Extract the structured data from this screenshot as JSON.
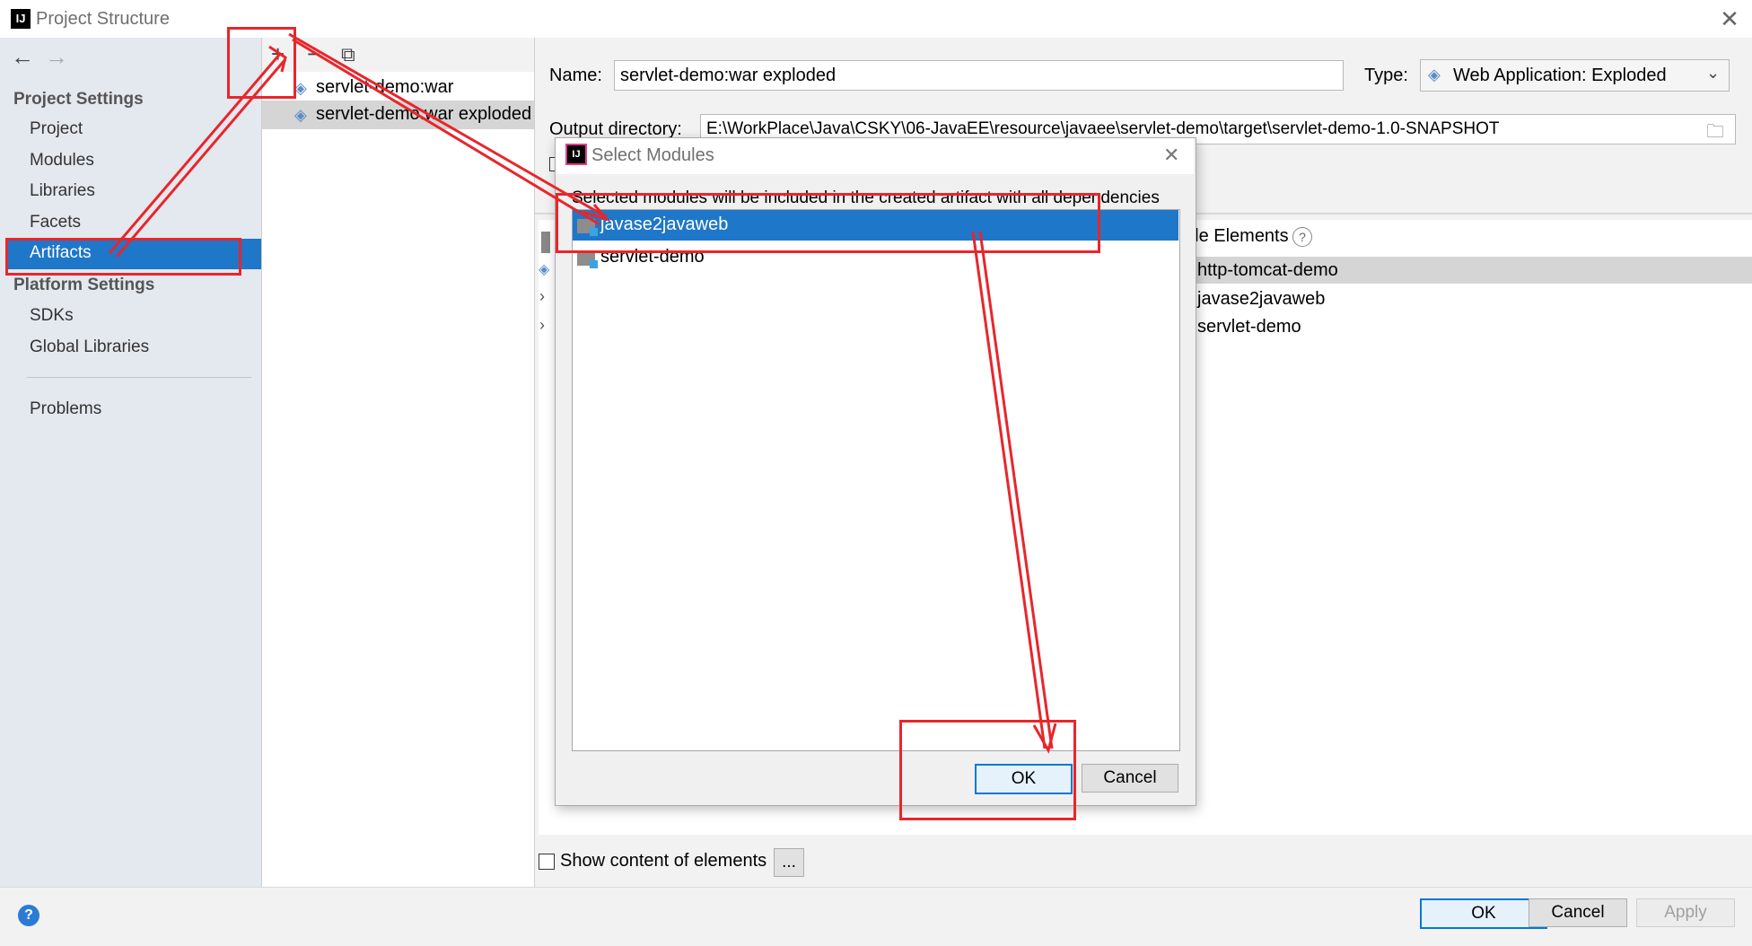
{
  "window": {
    "title": "Project Structure",
    "logo_text": "IJ",
    "close_glyph": "✕"
  },
  "nav": {
    "back_glyph": "←",
    "forward_glyph": "→",
    "project_settings_header": "Project Settings",
    "project_items": [
      "Project",
      "Modules",
      "Libraries",
      "Facets",
      "Artifacts"
    ],
    "platform_settings_header": "Platform Settings",
    "platform_items": [
      "SDKs",
      "Global Libraries"
    ],
    "problems": "Problems"
  },
  "artifacts_toolbar": {
    "add": "+",
    "remove": "−",
    "copy": "⧉"
  },
  "artifacts": [
    "servlet-demo:war",
    "servlet-demo:war exploded"
  ],
  "editor": {
    "name_label": "Name:",
    "name_value": "servlet-demo:war exploded",
    "type_label": "Type:",
    "type_value": "Web Application: Exploded",
    "output_label": "Output directory:",
    "output_value": "E:\\WorkPlace\\Java\\CSKY\\06-JavaEE\\resource\\javaee\\servlet-demo\\target\\servlet-demo-1.0-SNAPSHOT",
    "available_elements_partial": "ble Elements",
    "help_glyph": "?",
    "available_items": [
      "http-tomcat-demo",
      "javase2javaweb",
      "servlet-demo"
    ],
    "show_content_label": "Show content of elements",
    "ellipsis_button": "..."
  },
  "dialog": {
    "title": "Select Modules",
    "close_glyph": "✕",
    "description": "Selected modules will be included in the created artifact with all dependencies",
    "modules": [
      "javase2javaweb",
      "servlet-demo"
    ],
    "ok": "OK",
    "cancel": "Cancel"
  },
  "footer": {
    "help": "?",
    "ok": "OK",
    "cancel": "Cancel",
    "apply": "Apply"
  },
  "colors": {
    "selection": "#1f77c9",
    "annotation": "#e8262b",
    "focus_border": "#0078d7"
  }
}
